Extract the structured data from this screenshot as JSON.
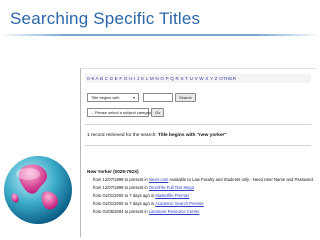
{
  "slide": {
    "title": "Searching Specific Titles"
  },
  "screenshot": {
    "alphabet": "0-9 A B C D E F G H I J K L M N O P Q R S T U V W X Y Z OTHER",
    "search_type": "Title begins with",
    "search_button": "Search",
    "subject_select": "-- Please select a subject category --",
    "go_button": "Go",
    "result_text": "1 record retrieved for the search: ",
    "result_query": "Title begins with \"new yorker\"",
    "entry_title": "New Yorker (0028-792X)",
    "holdings": [
      {
        "prefix": "from 12/07/1999 to present in ",
        "link": "Nexis.com",
        "suffix": " Available to Law Faculty and Students only - Need User Name and Password."
      },
      {
        "prefix": "from 12/07/1999 to present in ",
        "link": "OmniFile Full Text Mega",
        "suffix": ""
      },
      {
        "prefix": "from 01/01/2002 to 7 days ago in ",
        "link": "Masterfile Premier",
        "suffix": ""
      },
      {
        "prefix": "from 01/01/2002 to 7 days ago in ",
        "link": "Academic Search Premier",
        "suffix": ""
      },
      {
        "prefix": "from 01/05/2004 to present in ",
        "link": "Literature Resource Center",
        "suffix": ""
      }
    ]
  }
}
